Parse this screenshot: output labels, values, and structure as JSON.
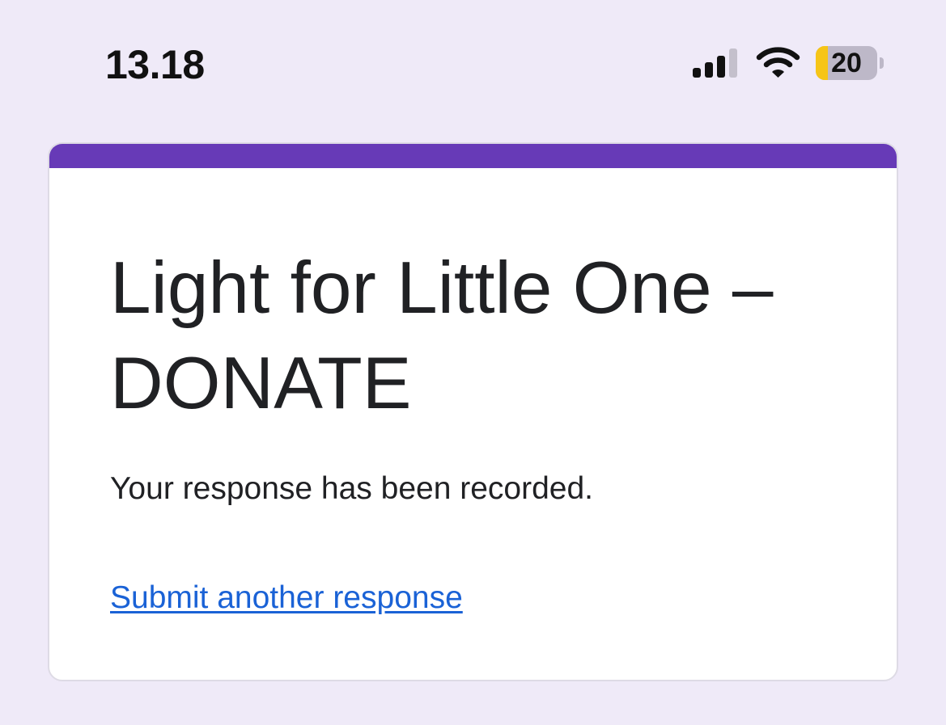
{
  "status_bar": {
    "time": "13.18",
    "signal_icon": "cellular-signal-icon",
    "wifi_icon": "wifi-icon",
    "battery_level_text": "20",
    "battery_level_fraction": 0.2,
    "battery_fill_color": "#f6c517"
  },
  "form": {
    "accent_color": "#673ab7",
    "title": "Light for Little One – DONATE",
    "confirmation_message": "Your response has been recorded.",
    "submit_another_link": "Submit another response",
    "link_color": "#1a62d6"
  }
}
